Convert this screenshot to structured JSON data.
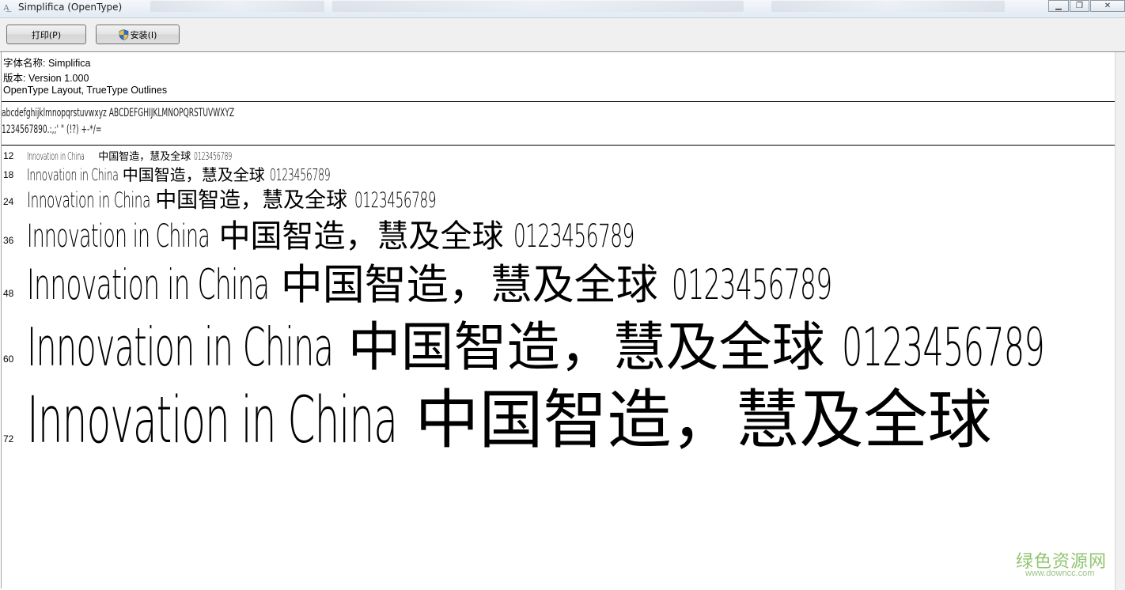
{
  "window": {
    "title": "Simplifica (OpenType)",
    "app_icon": "font-file-icon",
    "controls": {
      "minimize_icon": "minimize-icon",
      "maximize_icon": "maximize-icon",
      "close_icon": "close-icon"
    }
  },
  "toolbar": {
    "print_label": "打印(P)",
    "install_label": "安装(I)",
    "install_icon": "uac-shield-icon"
  },
  "font_info": {
    "name_line": "字体名称: Simplifica",
    "version_line": "版本: Version 1.000",
    "type_line": "OpenType Layout, TrueType Outlines"
  },
  "charset": {
    "line1": "abcdefghijklmnopqrstuvwxyz ABCDEFGHIJKLMNOPQRSTUVWXYZ",
    "line2": "1234567890.:,;' \" (!?) +-*/="
  },
  "samples": [
    {
      "size": "12",
      "latin": "Innovation in China",
      "cjk": "中国智造，慧及全球",
      "digits": "0123456789"
    },
    {
      "size": "18",
      "latin": "Innovation in China",
      "cjk": "中国智造，慧及全球",
      "digits": "0123456789"
    },
    {
      "size": "24",
      "latin": "Innovation in China",
      "cjk": "中国智造，慧及全球",
      "digits": "0123456789"
    },
    {
      "size": "36",
      "latin": "Innovation in China",
      "cjk": "中国智造，慧及全球",
      "digits": "0123456789"
    },
    {
      "size": "48",
      "latin": "Innovation in China",
      "cjk": "中国智造，慧及全球",
      "digits": "0123456789"
    },
    {
      "size": "60",
      "latin": "Innovation in China",
      "cjk": "中国智造，慧及全球",
      "digits": "0123456789"
    },
    {
      "size": "72",
      "latin": "Innovation in China",
      "cjk": "中国智造，慧及全球",
      "digits": ""
    }
  ],
  "watermark": {
    "text": "绿色资源网",
    "url": "www.downcc.com"
  }
}
